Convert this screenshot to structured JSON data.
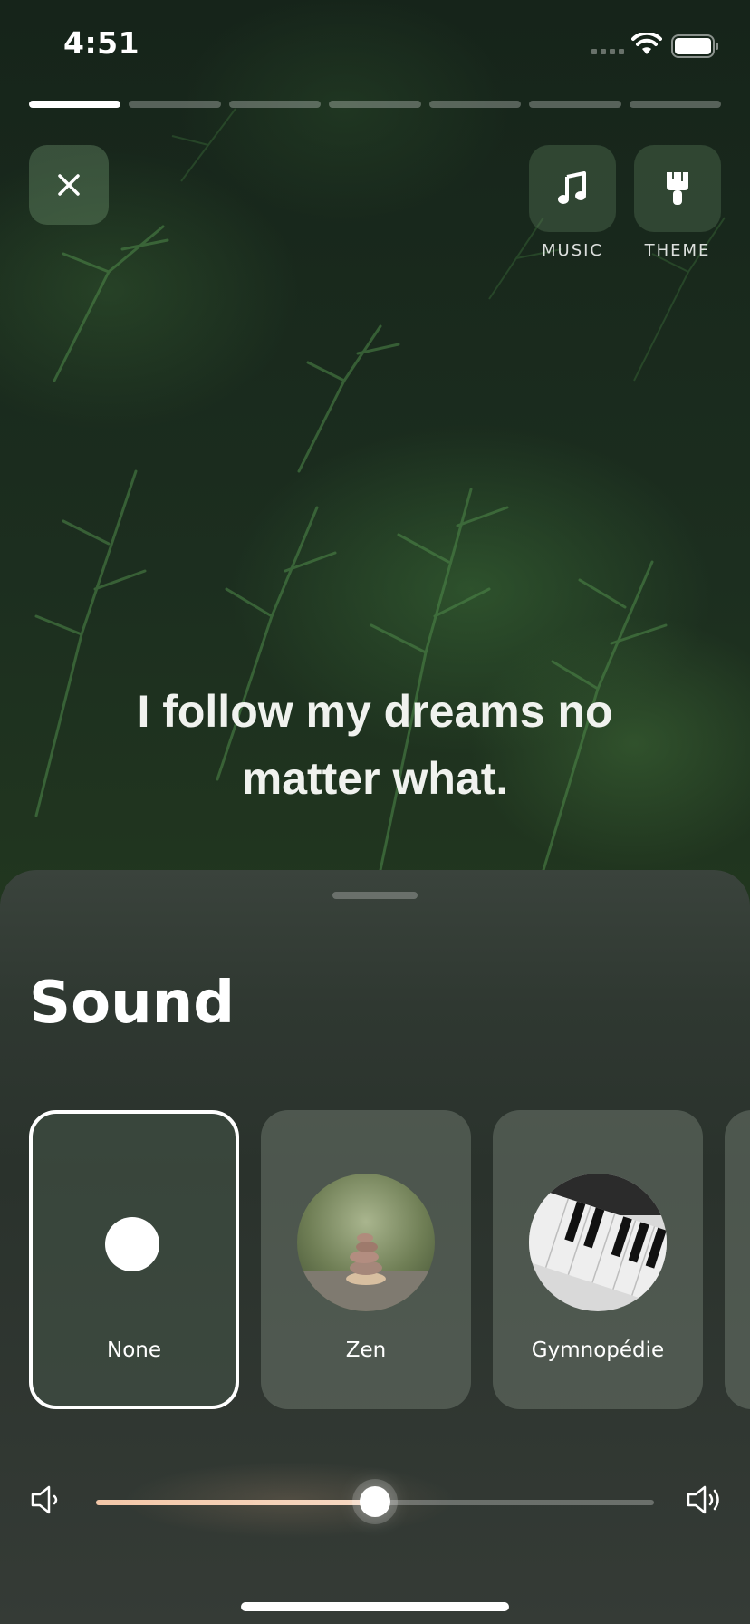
{
  "status_bar": {
    "time": "4:51"
  },
  "story_progress": {
    "segments": 7,
    "active_index": 0
  },
  "header": {
    "close_icon": "close-icon",
    "music": {
      "label": "MUSIC",
      "icon": "music-note-icon"
    },
    "theme": {
      "label": "THEME",
      "icon": "paint-brush-icon"
    }
  },
  "affirmation": {
    "text": "I follow my dreams no matter what."
  },
  "sheet": {
    "title": "Sound",
    "sounds": [
      {
        "name": "None",
        "selected": true
      },
      {
        "name": "Zen",
        "selected": false
      },
      {
        "name": "Gymnopédie",
        "selected": false
      }
    ],
    "volume": {
      "level": 0.5,
      "low_icon": "speaker-low-icon",
      "high_icon": "speaker-high-icon"
    }
  },
  "colors": {
    "slider_fill": "#f3c7a8",
    "sheet_bg": "#2f3831"
  }
}
